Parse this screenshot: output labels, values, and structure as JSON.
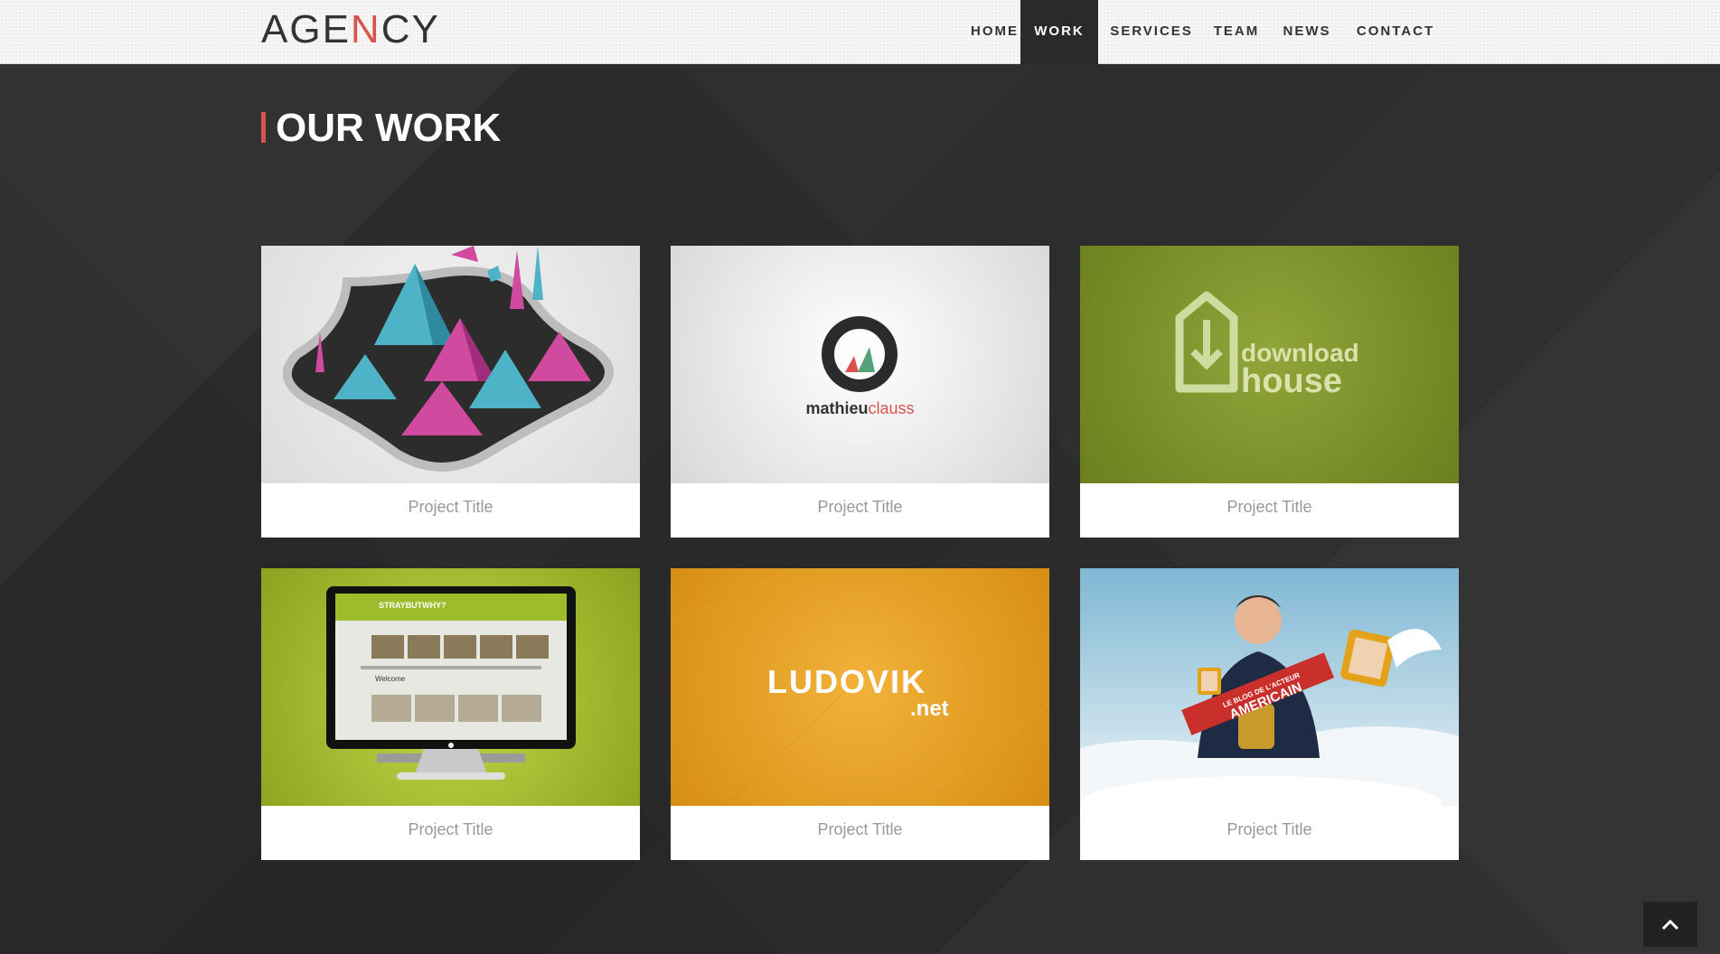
{
  "header": {
    "logo": {
      "pre": "AGE",
      "accent": "N",
      "post": "CY"
    },
    "nav": [
      {
        "label": "HOME",
        "active": false
      },
      {
        "label": "WORK",
        "active": true
      },
      {
        "label": "SERVICES",
        "active": false
      },
      {
        "label": "TEAM",
        "active": false
      },
      {
        "label": "NEWS",
        "active": false
      },
      {
        "label": "CONTACT",
        "active": false
      }
    ]
  },
  "main": {
    "section_title": "OUR WORK",
    "projects": [
      {
        "caption": "Project Title",
        "image": "abstract-pyramids-illustration"
      },
      {
        "caption": "Project Title",
        "image": "mathieuclauss-logo",
        "logo_text_1": "mathieu",
        "logo_text_2": "clauss"
      },
      {
        "caption": "Project Title",
        "image": "downloadhouse-logo",
        "logo_text_1": "download",
        "logo_text_2": "house"
      },
      {
        "caption": "Project Title",
        "image": "monitor-website-mockup",
        "screen_text_1": "STRAYBUTWHY?",
        "screen_text_2": "Welcome"
      },
      {
        "caption": "Project Title",
        "image": "ludovik-logo",
        "logo_text_1": "LUDOVIK",
        "logo_text_2": ".net"
      },
      {
        "caption": "Project Title",
        "image": "man-in-clouds-photo",
        "banner_text_1": "LE BLOG DE L'ACTEUR",
        "banner_text_2": "AMERICAIN"
      }
    ]
  },
  "colors": {
    "accent": "#d9534f",
    "background": "#2a2a2b",
    "header": "#f6f6f6"
  },
  "scroll_top": {
    "icon": "chevron-up-icon"
  }
}
